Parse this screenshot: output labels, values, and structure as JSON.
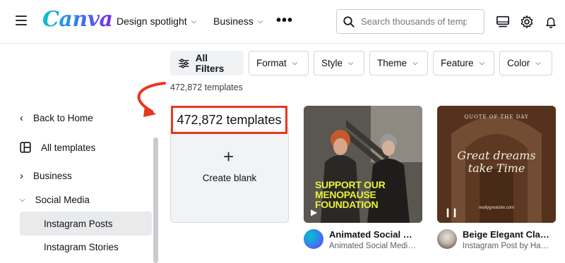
{
  "header": {
    "logo": "Canva",
    "nav": [
      {
        "label": "Design spotlight"
      },
      {
        "label": "Business"
      }
    ],
    "more": "•••",
    "search_placeholder": "Search thousands of templates"
  },
  "filters": {
    "all_filters": "All Filters",
    "buttons": [
      "Format",
      "Style",
      "Theme",
      "Feature",
      "Color"
    ]
  },
  "results": {
    "count_small": "472,872 templates",
    "count_big": "472,872 templates"
  },
  "sidebar": {
    "back": "Back to Home",
    "all_templates": "All templates",
    "business": "Business",
    "social_media": "Social Media",
    "instagram_posts": "Instagram Posts",
    "instagram_stories": "Instagram Stories"
  },
  "blank": {
    "label": "Create blank"
  },
  "templates": [
    {
      "title": "Animated Social Me...",
      "subtitle": "Animated Social Media ...",
      "image_text": "SUPPORT OUR MENOPAUSE FOUNDATION"
    },
    {
      "title": "Beige Elegant Classi...",
      "subtitle": "Instagram Post by Hann...",
      "image_top": "QUOTE OF THE DAY",
      "image_main1": "Great dreams",
      "image_main2": "take Time",
      "image_sub": "reallygreatsite.com"
    }
  ],
  "colors": {
    "accent_red": "#e8361f",
    "tpl1_text": "#e8f23a"
  }
}
